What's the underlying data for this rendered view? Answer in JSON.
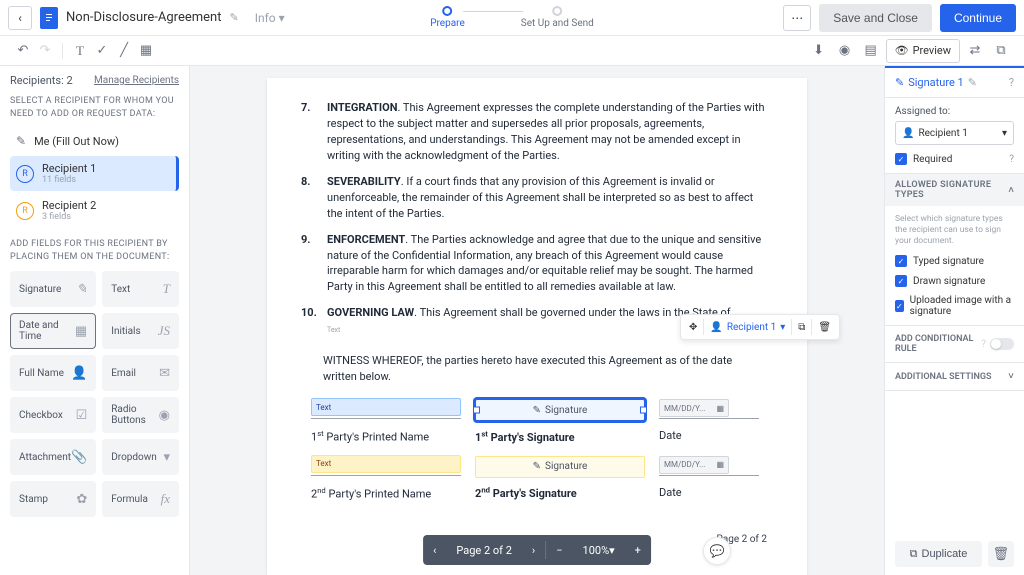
{
  "header": {
    "doc_title": "Non-Disclosure-Agreement",
    "info_label": "Info",
    "steps": {
      "prepare": "Prepare",
      "setup": "Set Up and Send"
    },
    "save_close": "Save and Close",
    "continue": "Continue",
    "preview": "Preview"
  },
  "left": {
    "recipients_count": "Recipients: 2",
    "manage": "Manage Recipients",
    "select_caption": "SELECT A RECIPIENT FOR WHOM YOU NEED TO ADD OR REQUEST DATA:",
    "me": "Me (Fill Out Now)",
    "r1": {
      "name": "Recipient 1",
      "sub": "11 fields"
    },
    "r2": {
      "name": "Recipient 2",
      "sub": "3 fields"
    },
    "fields_caption": "ADD FIELDS FOR THIS RECIPIENT BY PLACING THEM ON THE DOCUMENT:",
    "tiles": {
      "signature": "Signature",
      "text": "Text",
      "date_time": "Date and Time",
      "initials": "Initials",
      "full_name": "Full Name",
      "email": "Email",
      "checkbox": "Checkbox",
      "radio": "Radio Buttons",
      "attachment": "Attachment",
      "dropdown": "Dropdown",
      "stamp": "Stamp",
      "formula": "Formula"
    }
  },
  "doc": {
    "items": [
      {
        "n": "7.",
        "title": "INTEGRATION",
        "text": ". This Agreement expresses the complete understanding of the Parties with respect to the subject matter and supersedes all prior proposals, agreements, representations, and understandings. This Agreement may not be amended except in writing with the acknowledgment of the Parties."
      },
      {
        "n": "8.",
        "title": "SEVERABILITY",
        "text": ". If a court finds that any provision of this Agreement is invalid or unenforceable, the remainder of this Agreement shall be interpreted so as best to affect the intent of the Parties."
      },
      {
        "n": "9.",
        "title": "ENFORCEMENT",
        "text": ". The Parties acknowledge and agree that due to the unique and sensitive nature of the Confidential Information, any breach of this Agreement would cause irreparable harm for which damages and/or equitable relief may be sought. The harmed Party in this Agreement shall be entitled to all remedies available at law."
      },
      {
        "n": "10.",
        "title": "GOVERNING LAW",
        "text": ". This Agreement shall be governed under the laws in the State of"
      }
    ],
    "field_text_label": "Text",
    "witness": "WITNESS WHEREOF, the parties hereto have executed this Agreement as of the date written below.",
    "row1": {
      "name": "Party's Printed Name",
      "sig": "Party's Signature",
      "date": "Date"
    },
    "row2": {
      "name": "Party's Printed Name",
      "sig": "Party's Signature",
      "date": "Date"
    },
    "sig_label": "Signature",
    "date_placeholder": "MM/DD/Y...",
    "page_num": "Page 2 of 2"
  },
  "floating": {
    "recipient": "Recipient 1"
  },
  "pager": {
    "page": "Page 2 of 2",
    "zoom": "100%"
  },
  "right": {
    "title": "Signature 1",
    "assigned_to": "Assigned to:",
    "assigned_value": "Recipient 1",
    "required": "Required",
    "allowed_header": "ALLOWED SIGNATURE TYPES",
    "allowed_help": "Select which signature types the recipient can use to sign your document.",
    "typed": "Typed signature",
    "drawn": "Drawn signature",
    "uploaded": "Uploaded image with a signature",
    "conditional": "ADD CONDITIONAL RULE",
    "additional": "ADDITIONAL SETTINGS",
    "duplicate": "Duplicate"
  }
}
